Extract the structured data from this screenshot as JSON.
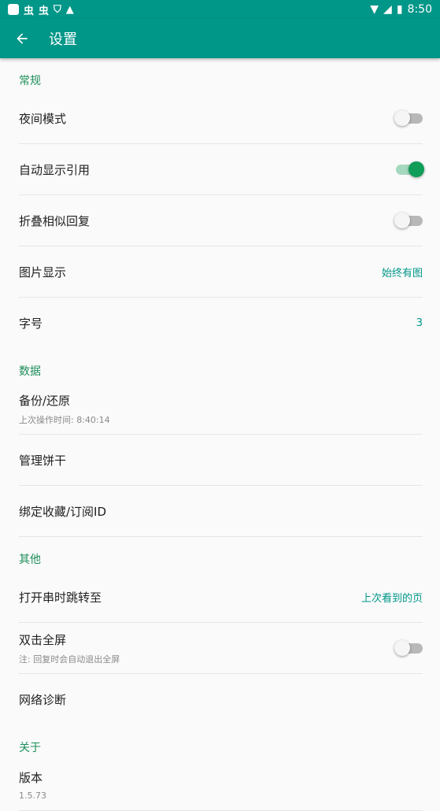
{
  "status_bar": {
    "time": "8:50",
    "left_glyphs": [
      "虫",
      "虫"
    ]
  },
  "toolbar": {
    "title": "设置"
  },
  "sections": {
    "general": {
      "header": "常规",
      "night_mode": {
        "title": "夜间模式",
        "on": false
      },
      "auto_show_quote": {
        "title": "自动显示引用",
        "on": true
      },
      "fold_similar": {
        "title": "折叠相似回复",
        "on": false
      },
      "image_display": {
        "title": "图片显示",
        "value": "始终有图"
      },
      "font_size": {
        "title": "字号",
        "value": "3"
      }
    },
    "data": {
      "header": "数据",
      "backup": {
        "title": "备份/还原",
        "subtitle": "上次操作时间: 8:40:14"
      },
      "cookies": {
        "title": "管理饼干"
      },
      "bind_id": {
        "title": "绑定收藏/订阅ID"
      }
    },
    "other": {
      "header": "其他",
      "open_thread": {
        "title": "打开串时跳转至",
        "value": "上次看到的页"
      },
      "double_tap": {
        "title": "双击全屏",
        "subtitle": "注: 回复时会自动退出全屏",
        "on": false
      },
      "network": {
        "title": "网络诊断"
      }
    },
    "about": {
      "header": "关于",
      "version": {
        "title": "版本",
        "subtitle": "1.5.73"
      }
    }
  },
  "colors": {
    "primary": "#009688",
    "accent": "#0f9d58",
    "section": "#1e8f5a"
  }
}
